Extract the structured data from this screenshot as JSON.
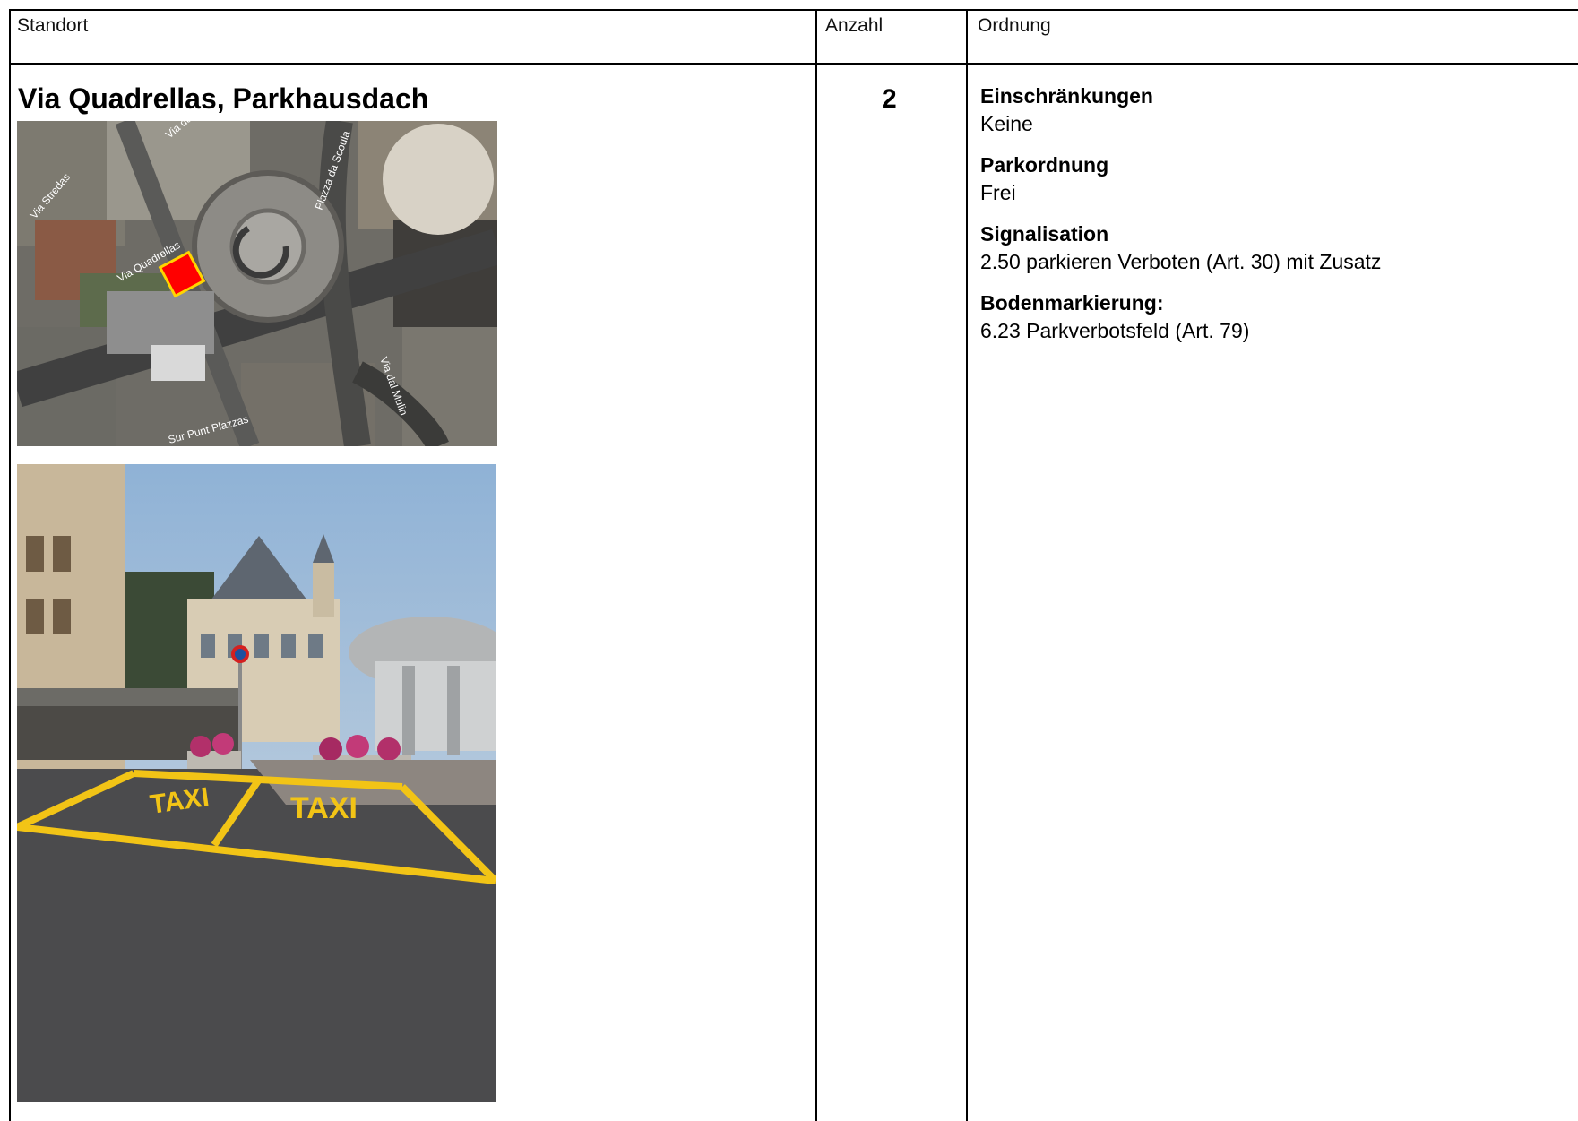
{
  "table": {
    "headers": {
      "standort": "Standort",
      "anzahl": "Anzahl",
      "ordnung": "Ordnung"
    },
    "row": {
      "standort_title": "Via Quadrellas, Parkhausdach",
      "anzahl": "2",
      "ordnung": [
        {
          "heading": "Einschränkungen",
          "value": "Keine"
        },
        {
          "heading": "Parkordnung",
          "value": "Frei"
        },
        {
          "heading": "Signalisation",
          "value": "2.50 parkieren Verboten (Art. 30) mit Zusatz"
        },
        {
          "heading": "Bodenmarkierung:",
          "value": "6.23 Parkverbotsfeld (Art. 79)"
        }
      ]
    }
  },
  "map": {
    "street_labels": [
      "Via Stredas",
      "Via dal'Alp",
      "Via Quadrellas",
      "Plazza da Scoula",
      "Via dal Mulin",
      "Sur Punt Plazzas"
    ],
    "marker_color": "#ff0000"
  },
  "photo": {
    "road_marking_text": [
      "TAXI",
      "TAXI"
    ],
    "marking_color": "#f2c416"
  }
}
